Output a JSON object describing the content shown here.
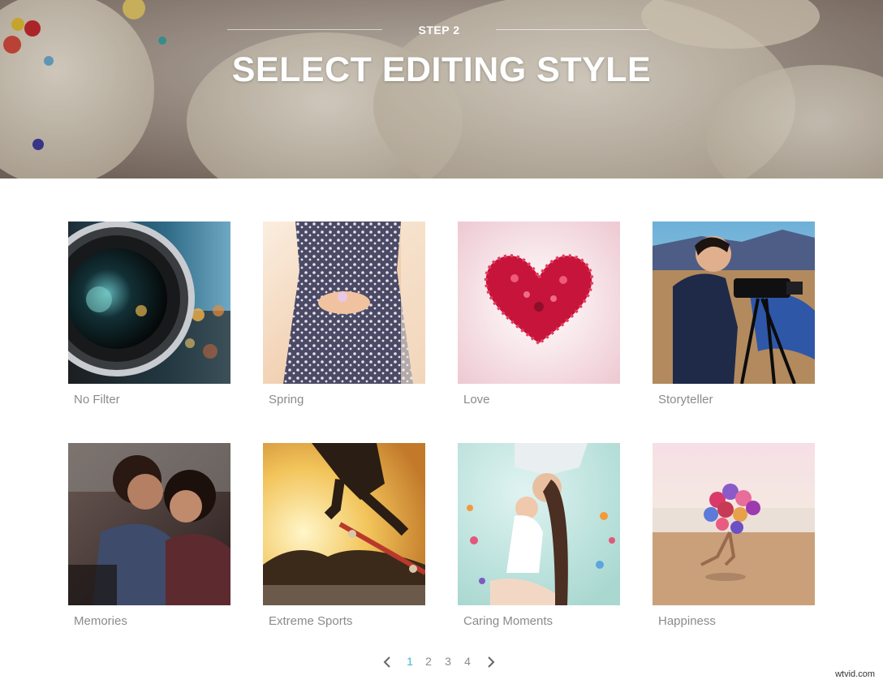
{
  "header": {
    "step_label": "STEP 2",
    "title": "SELECT EDITING STYLE"
  },
  "styles": [
    {
      "label": "No Filter"
    },
    {
      "label": "Spring"
    },
    {
      "label": "Love"
    },
    {
      "label": "Storyteller"
    },
    {
      "label": "Memories"
    },
    {
      "label": "Extreme Sports"
    },
    {
      "label": "Caring Moments"
    },
    {
      "label": "Happiness"
    }
  ],
  "pagination": {
    "pages": [
      "1",
      "2",
      "3",
      "4"
    ],
    "current": "1",
    "prev_icon": "chevron-left-icon",
    "next_icon": "chevron-right-icon"
  },
  "watermark": "wtvid.com",
  "colors": {
    "accent": "#3fb4d2",
    "label": "#8b8b8b"
  }
}
